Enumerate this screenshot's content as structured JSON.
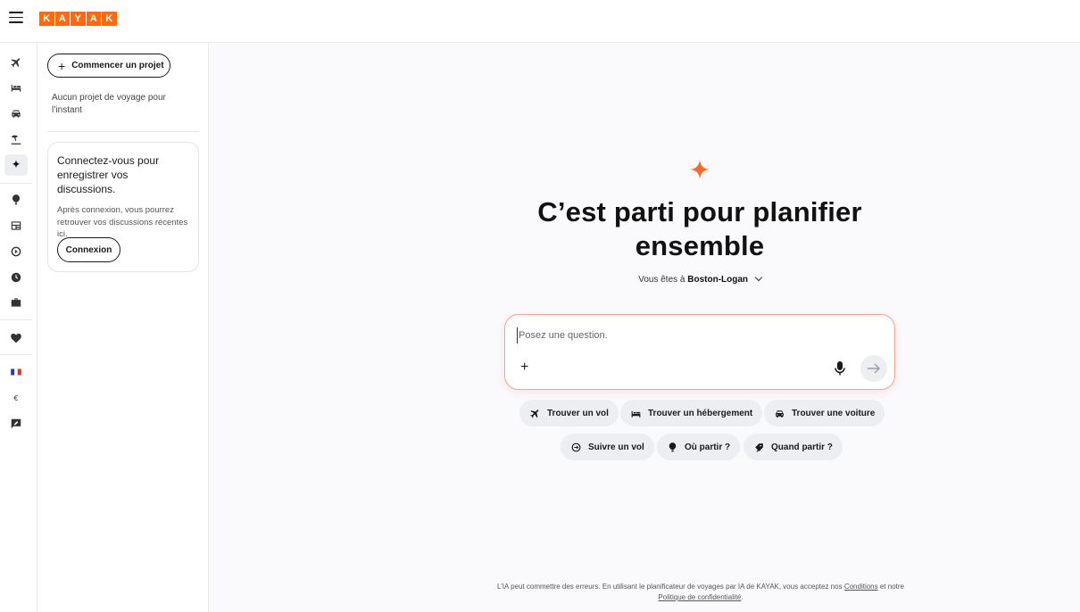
{
  "header": {
    "menu_icon": "hamburger-menu-icon",
    "logo_letters": [
      "K",
      "A",
      "Y",
      "A",
      "K"
    ],
    "brand_color": "#ff690f"
  },
  "rail": {
    "items": [
      {
        "icon": "plane-icon",
        "label": "Vols"
      },
      {
        "icon": "bed-icon",
        "label": "Hébergements"
      },
      {
        "icon": "car-icon",
        "label": "Voitures"
      },
      {
        "icon": "beach-umbrella-icon",
        "label": "Forfaits"
      },
      {
        "icon": "sparkle-icon",
        "label": "Planificateur IA",
        "active": true
      },
      {
        "icon": "explore-balloon-icon",
        "label": "Explorer"
      },
      {
        "icon": "news-icon",
        "label": "Actualités"
      },
      {
        "icon": "flight-tracker-icon",
        "label": "Suivi de vol"
      },
      {
        "icon": "clock-icon",
        "label": "Meilleur moment"
      },
      {
        "icon": "briefcase-icon",
        "label": "Voyages"
      },
      {
        "icon": "heart-icon",
        "label": "Favoris"
      },
      {
        "icon": "france-flag-icon",
        "label": "Langue"
      },
      {
        "icon": "euro-icon",
        "label": "€"
      },
      {
        "icon": "feedback-icon",
        "label": "Commentaires"
      }
    ]
  },
  "panel": {
    "start_project_label": "Commencer un projet",
    "no_project_text": "Aucun projet de voyage pour l’instant",
    "login_card": {
      "title": "Connectez-vous pour enregistrer vos discussions.",
      "description": "Après connexion, vous pourrez retrouver vos discussions récentes ici.",
      "button_label": "Connexion"
    }
  },
  "main": {
    "headline": "C’est parti pour planifier ensemble",
    "location_prefix": "Vous êtes à",
    "location_value": "Boston-Logan",
    "ask_placeholder": "Posez une question.",
    "chips": [
      {
        "icon": "plane-icon",
        "label": "Trouver un vol"
      },
      {
        "icon": "bed-icon",
        "label": "Trouver un hébergement"
      },
      {
        "icon": "car-icon",
        "label": "Trouver une voiture"
      },
      {
        "icon": "flight-tracker-icon",
        "label": "Suivre un vol"
      },
      {
        "icon": "explore-balloon-icon",
        "label": "Où partir ?"
      },
      {
        "icon": "calendar-plane-icon",
        "label": "Quand partir ?"
      }
    ],
    "accent_color": "#f06b2c"
  },
  "footer": {
    "text_before": "L’IA peut commettre des erreurs. En utilisant le planificateur de voyages par IA de KAYAK, vous acceptez nos",
    "conditions_link": "Conditions",
    "text_middle": "et notre",
    "privacy_link": "Politique de confidentialité",
    "text_end": "."
  }
}
